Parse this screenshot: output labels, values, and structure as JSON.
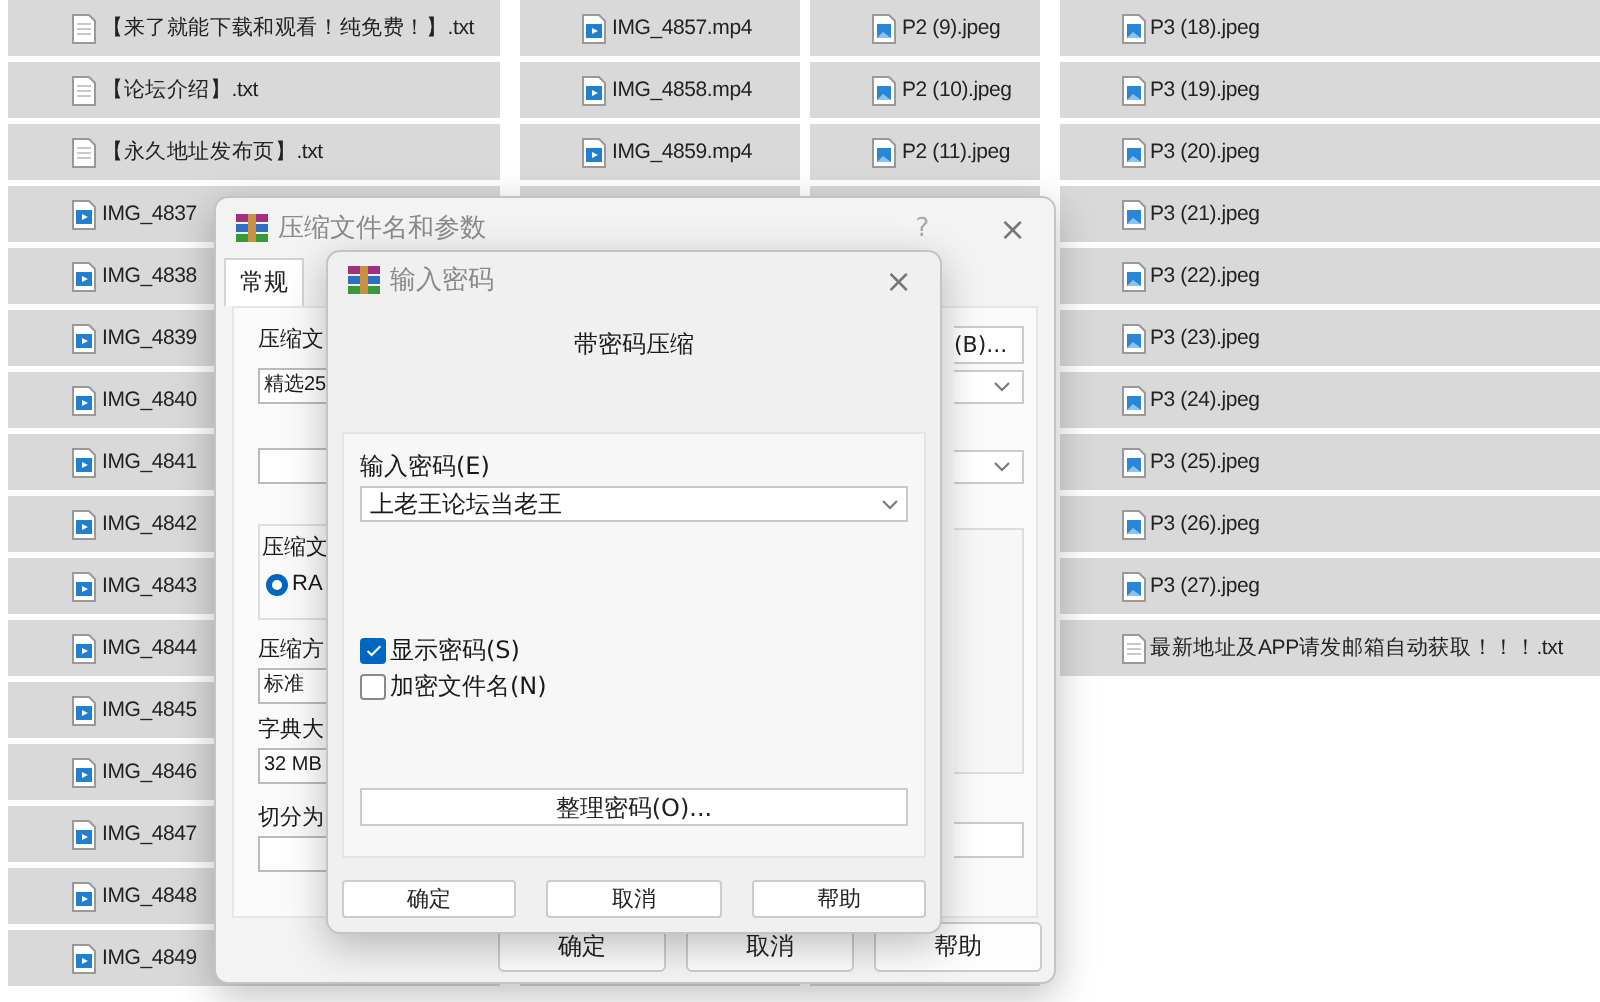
{
  "explorer": {
    "columns": [
      {
        "items": [
          {
            "name": "【来了就能下载和观看！纯免费！】.txt",
            "kind": "txt"
          },
          {
            "name": "【论坛介绍】.txt",
            "kind": "txt"
          },
          {
            "name": "【永久地址发布页】.txt",
            "kind": "txt"
          },
          {
            "name": "IMG_4837",
            "kind": "video"
          },
          {
            "name": "IMG_4838",
            "kind": "video"
          },
          {
            "name": "IMG_4839",
            "kind": "video"
          },
          {
            "name": "IMG_4840",
            "kind": "video"
          },
          {
            "name": "IMG_4841",
            "kind": "video"
          },
          {
            "name": "IMG_4842",
            "kind": "video"
          },
          {
            "name": "IMG_4843",
            "kind": "video"
          },
          {
            "name": "IMG_4844",
            "kind": "video"
          },
          {
            "name": "IMG_4845",
            "kind": "video"
          },
          {
            "name": "IMG_4846",
            "kind": "video"
          },
          {
            "name": "IMG_4847",
            "kind": "video"
          },
          {
            "name": "IMG_4848",
            "kind": "video"
          },
          {
            "name": "IMG_4849",
            "kind": "video"
          }
        ]
      },
      {
        "items": [
          {
            "name": "IMG_4857.mp4",
            "kind": "video"
          },
          {
            "name": "IMG_4858.mp4",
            "kind": "video"
          },
          {
            "name": "IMG_4859.mp4",
            "kind": "video"
          }
        ]
      },
      {
        "items": [
          {
            "name": "P2 (9).jpeg",
            "kind": "image"
          },
          {
            "name": "P2 (10).jpeg",
            "kind": "image"
          },
          {
            "name": "P2 (11).jpeg",
            "kind": "image"
          }
        ]
      },
      {
        "items": [
          {
            "name": "P3 (18).jpeg",
            "kind": "image"
          },
          {
            "name": "P3 (19).jpeg",
            "kind": "image"
          },
          {
            "name": "P3 (20).jpeg",
            "kind": "image"
          },
          {
            "name": "P3 (21).jpeg",
            "kind": "image"
          },
          {
            "name": "P3 (22).jpeg",
            "kind": "image"
          },
          {
            "name": "P3 (23).jpeg",
            "kind": "image"
          },
          {
            "name": "P3 (24).jpeg",
            "kind": "image"
          },
          {
            "name": "P3 (25).jpeg",
            "kind": "image"
          },
          {
            "name": "P3 (26).jpeg",
            "kind": "image"
          },
          {
            "name": "P3 (27).jpeg",
            "kind": "image"
          },
          {
            "name": "最新地址及APP请发邮箱自动获取！！！.txt",
            "kind": "txt"
          }
        ]
      }
    ]
  },
  "compress_dialog": {
    "title": "压缩文件名和参数",
    "help": "?",
    "close": "×",
    "tabs": [
      {
        "label": "常规",
        "selected": true
      }
    ],
    "archive_label": "压缩文",
    "archive_name": "精选25",
    "browse_button": "(B)...",
    "format_group": "压缩文",
    "format_option": {
      "label": "RA",
      "selected": true
    },
    "method_label": "压缩方",
    "method_value": "标准",
    "dictionary_label": "字典大",
    "dictionary_value": "32 MB",
    "split_label": "切分为",
    "buttons": [
      "确定",
      "取消",
      "帮助"
    ]
  },
  "password_dialog": {
    "title": "输入密码",
    "close": "×",
    "heading": "带密码压缩",
    "password_label": "输入密码(E)",
    "password_value": "上老王论坛当老王",
    "options": [
      {
        "label": "显示密码(S)",
        "checked": true
      },
      {
        "label": "加密文件名(N)",
        "checked": false
      }
    ],
    "organize_button": "整理密码(O)...",
    "buttons": [
      "确定",
      "取消",
      "帮助"
    ]
  }
}
